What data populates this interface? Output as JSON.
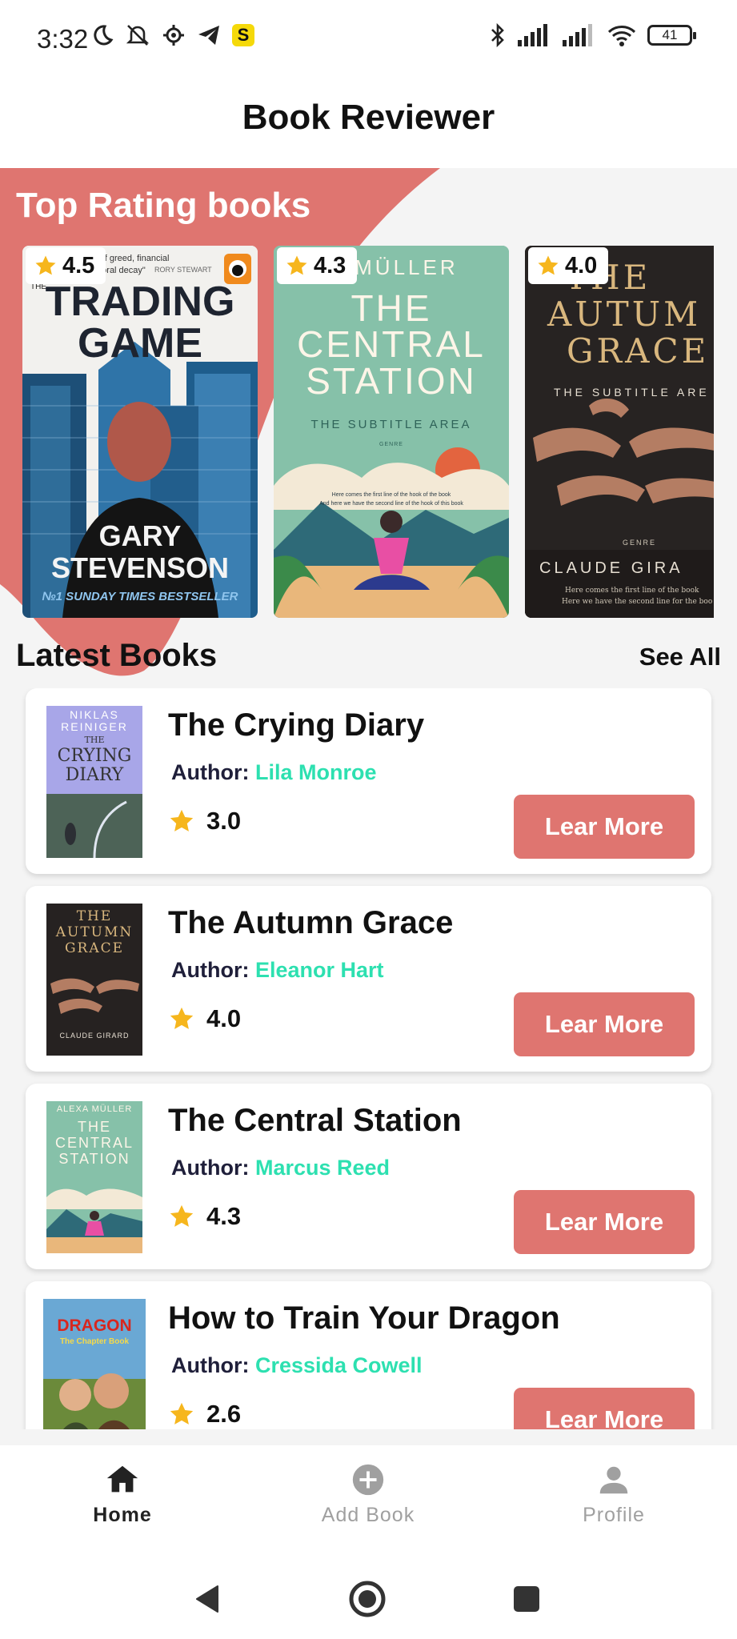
{
  "status_bar": {
    "time": "3:32",
    "battery": "41"
  },
  "app": {
    "title": "Book Reviewer"
  },
  "top_rating": {
    "title": "Top Rating books",
    "books": [
      {
        "rating": "4.5",
        "cover_text": [
          "ple story of greed, financial",
          "moral decay\"",
          "RORY STEWART",
          "THE",
          "TRADING",
          "GAME",
          "GARY",
          "STEVENSON",
          "№1 SUNDAY TIMES BESTSELLER"
        ]
      },
      {
        "rating": "4.3",
        "cover_text": [
          "A MÜLLER",
          "THE",
          "CENTRAL",
          "STATION",
          "THE SUBTITLE AREA",
          "GENRE",
          "Here comes the first line of the hook of the book",
          "And here we have the second line of the hook of this book"
        ]
      },
      {
        "rating": "4.0",
        "cover_text": [
          "THE",
          "AUTUM",
          "GRACE",
          "THE SUBTITLE ARE",
          "GENRE",
          "CLAUDE GIRA",
          "Here comes the first line of the book",
          "Here we have the second line for the boo"
        ]
      }
    ]
  },
  "latest": {
    "title": "Latest Books",
    "see_all": "See All",
    "author_label": "Author:",
    "button_label": "Lear More",
    "books": [
      {
        "title": "The Crying Diary",
        "author": "Lila Monroe",
        "rating": "3.0",
        "thumb_text": [
          "NIKLAS",
          "REINIGER",
          "THE",
          "CRYING",
          "DIARY"
        ]
      },
      {
        "title": "The Autumn Grace",
        "author": "Eleanor Hart",
        "rating": "4.0",
        "thumb_text": [
          "THE",
          "AUTUMN",
          "GRACE",
          "CLAUDE GIRARD"
        ]
      },
      {
        "title": "The Central Station",
        "author": "Marcus Reed",
        "rating": "4.3",
        "thumb_text": [
          "ALEXA MÜLLER",
          "THE",
          "CENTRAL",
          "STATION"
        ]
      },
      {
        "title": "How to Train Your Dragon",
        "author": "Cressida Cowell",
        "rating": "2.6",
        "thumb_text": [
          "DRAGON",
          "The Chapter Book"
        ]
      }
    ]
  },
  "bottom_nav": [
    {
      "label": "Home",
      "icon": "home-icon",
      "active": true
    },
    {
      "label": "Add Book",
      "icon": "add-circle-icon",
      "active": false
    },
    {
      "label": "Profile",
      "icon": "person-icon",
      "active": false
    }
  ],
  "colors": {
    "accent": "#df7570",
    "author": "#2de0b0",
    "star": "#f6b61d",
    "nav_active": "#222222",
    "nav_inactive": "#a0a0a0"
  }
}
